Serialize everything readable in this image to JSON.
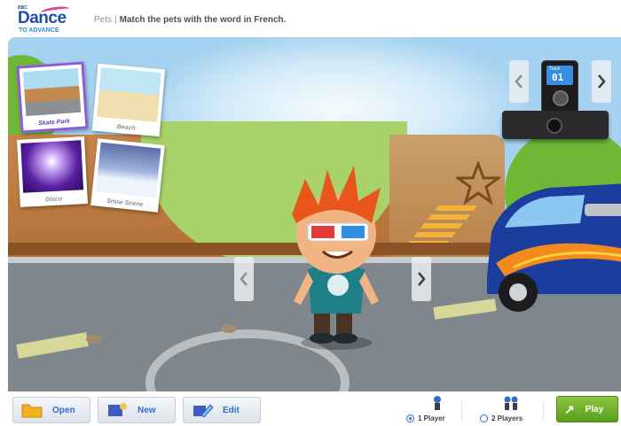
{
  "header": {
    "logo_small": "BBC",
    "logo_main": "Dance",
    "logo_sub": "TO ADVANCE",
    "section": "Pets",
    "separator": "|",
    "instruction": "Match the pets with the word in French."
  },
  "locations": [
    {
      "caption": "Skate Park",
      "selected": true
    },
    {
      "caption": "Beach",
      "selected": false
    },
    {
      "caption": "Disco",
      "selected": false
    },
    {
      "caption": "Snow Scene",
      "selected": false
    }
  ],
  "music_player": {
    "label": "Track",
    "number": "01"
  },
  "bottom": {
    "open_label": "Open",
    "new_label": "New",
    "edit_label": "Edit",
    "one_player_label": "1 Player",
    "two_players_label": "2 Players",
    "play_label": "Play",
    "selected_mode": "1 Player"
  },
  "colors": {
    "accent_blue": "#2c6fc7",
    "selected_purple": "#8c5bd6",
    "play_green": "#6fb22b"
  }
}
